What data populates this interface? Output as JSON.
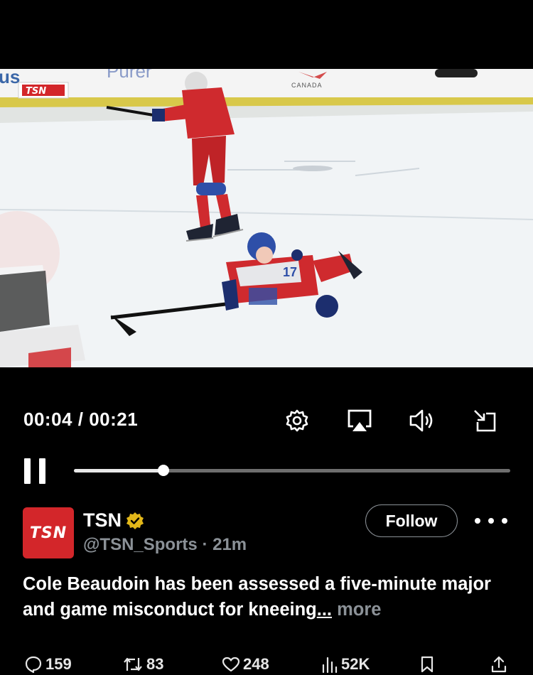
{
  "player": {
    "current_time": "00:04",
    "separator": "/",
    "duration": "00:21",
    "progress": 0.205,
    "board_text_left": "us",
    "board_text_mid": "Purer",
    "board_text_canada": "CANADA",
    "broadcaster_bug": "TSN",
    "jersey_number": "17",
    "icons": [
      "settings-icon",
      "airplay-icon",
      "volume-icon",
      "exit-fullscreen-icon",
      "pause-icon"
    ]
  },
  "tweet": {
    "avatar_text": "TSN",
    "name": "TSN",
    "verified": true,
    "handle": "@TSN_Sports",
    "dot": "·",
    "time": "21m",
    "follow_label": "Follow",
    "text": "Cole Beaudoin has been assessed a five-minute major and game misconduct for kneeing",
    "ellipsis": "...",
    "more_label": "more"
  },
  "actions": {
    "replies": "159",
    "reposts": "83",
    "likes": "248",
    "views": "52K"
  },
  "colors": {
    "background": "#000000",
    "avatar": "#d3262a",
    "verified_badge": "#e2b719",
    "secondary_text": "#8b9197",
    "ice": "#e9eef1",
    "board_yellow": "#d8c84a",
    "jersey_red": "#cf2a2e",
    "helmet_blue": "#2e4fa8"
  }
}
